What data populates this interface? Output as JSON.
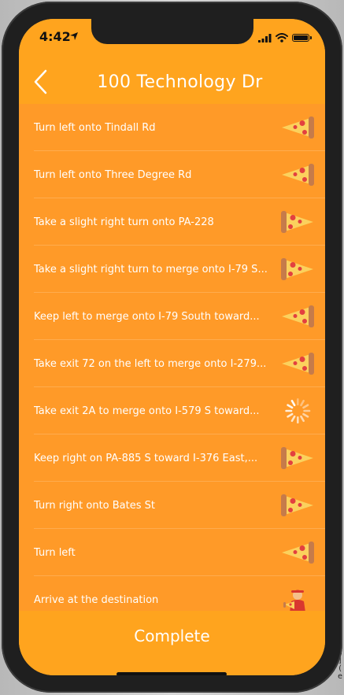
{
  "status": {
    "time": "4:42"
  },
  "nav": {
    "title": "100 Technology Dr"
  },
  "steps": [
    {
      "text": "Turn left onto Tindall Rd",
      "icon": "pizza-left-icon"
    },
    {
      "text": "Turn left onto Three Degree Rd",
      "icon": "pizza-left-icon"
    },
    {
      "text": "Take a slight right turn onto PA-228",
      "icon": "pizza-right-icon"
    },
    {
      "text": "Take a slight right turn to merge onto I-79 S...",
      "icon": "pizza-right-icon"
    },
    {
      "text": "Keep left to merge onto I-79 South toward...",
      "icon": "pizza-left-icon"
    },
    {
      "text": "Take exit 72 on the left to merge onto I-279...",
      "icon": "pizza-left-icon"
    },
    {
      "text": "Take exit 2A to merge onto I-579 S toward...",
      "icon": "loading-spinner-icon"
    },
    {
      "text": "Keep right on PA-885 S toward I-376 East,...",
      "icon": "pizza-right-icon"
    },
    {
      "text": "Turn right onto Bates St",
      "icon": "pizza-right-icon"
    },
    {
      "text": "Turn left",
      "icon": "pizza-left-icon"
    },
    {
      "text": "Arrive at the destination",
      "icon": "delivery-person-icon"
    }
  ],
  "footer": {
    "complete_label": "Complete"
  },
  "colors": {
    "accent": "#ffa41e",
    "list_bg": "#ff9a28",
    "text": "#ffffff"
  }
}
